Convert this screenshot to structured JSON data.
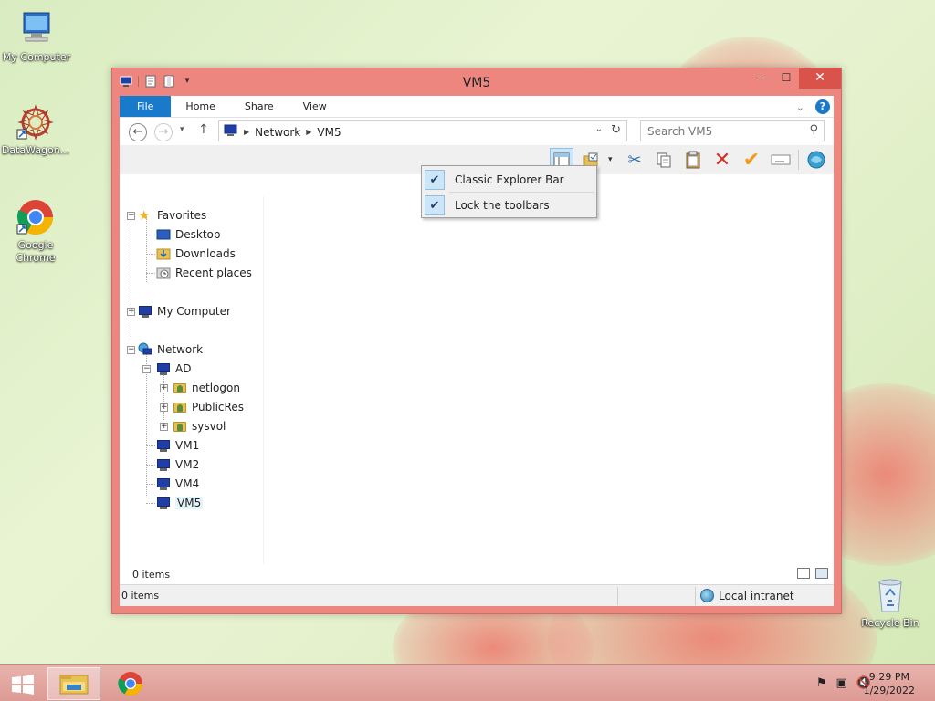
{
  "desktop": {
    "icons": [
      {
        "label": "My Computer"
      },
      {
        "label": "DataWagon..."
      },
      {
        "label": "Google Chrome"
      },
      {
        "label": "Recycle Bin"
      }
    ]
  },
  "window": {
    "title": "VM5",
    "tabs": {
      "file": "File",
      "home": "Home",
      "share": "Share",
      "view": "View"
    },
    "address": {
      "crumbs": [
        "Network",
        "VM5"
      ]
    },
    "search": {
      "placeholder": "Search VM5"
    },
    "tree": {
      "favorites": "Favorites",
      "desktop": "Desktop",
      "downloads": "Downloads",
      "recent": "Recent places",
      "computer": "My Computer",
      "network": "Network",
      "ad": "AD",
      "netlogon": "netlogon",
      "publicres": "PublicRes",
      "sysvol": "sysvol",
      "vm1": "VM1",
      "vm2": "VM2",
      "vm4": "VM4",
      "vm5": "VM5"
    },
    "items_count": "0 items",
    "status": {
      "count": "0 items",
      "zone": "Local intranet"
    }
  },
  "context_menu": {
    "items": [
      {
        "label": "Classic Explorer Bar",
        "checked": true
      },
      {
        "label": "Lock the toolbars",
        "checked": true
      }
    ]
  },
  "taskbar": {
    "time": "9:29 PM",
    "date": "1/29/2022"
  },
  "colors": {
    "window_frame": "#ee8680",
    "accent": "#1979ca",
    "close_button": "#d9534a"
  }
}
